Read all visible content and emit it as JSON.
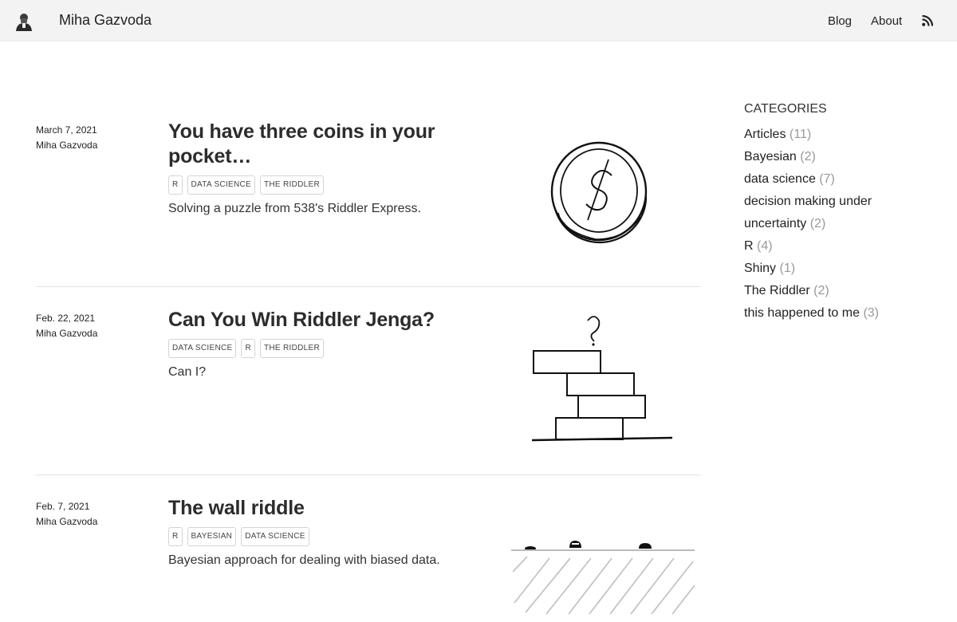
{
  "header": {
    "site_title": "Miha Gazvoda",
    "nav": {
      "blog": "Blog",
      "about": "About"
    },
    "icons": {
      "avatar": "author-avatar-icon",
      "feed": "rss-feed-icon"
    }
  },
  "posts": [
    {
      "date": "March 7, 2021",
      "author": "Miha Gazvoda",
      "title": "You have three coins in your pocket…",
      "tags": [
        "R",
        "DATA SCIENCE",
        "THE RIDDLER"
      ],
      "description": "Solving a puzzle from 538's Riddler Express.",
      "image": "coin-sketch-icon"
    },
    {
      "date": "Feb. 22, 2021",
      "author": "Miha Gazvoda",
      "title": "Can You Win Riddler Jenga?",
      "tags": [
        "DATA SCIENCE",
        "R",
        "THE RIDDLER"
      ],
      "description": "Can I?",
      "image": "jenga-tower-sketch-icon"
    },
    {
      "date": "Feb. 7, 2021",
      "author": "Miha Gazvoda",
      "title": "The wall riddle",
      "tags": [
        "R",
        "BAYESIAN",
        "DATA SCIENCE"
      ],
      "description": "Bayesian approach for dealing with biased data.",
      "image": "wall-sketch-icon"
    }
  ],
  "sidebar": {
    "heading": "CATEGORIES",
    "categories": [
      {
        "name": "Articles",
        "count": "(11)"
      },
      {
        "name": "Bayesian",
        "count": "(2)"
      },
      {
        "name": "data science",
        "count": "(7)"
      },
      {
        "name": "decision making under uncertainty",
        "count": "(2)"
      },
      {
        "name": "R",
        "count": "(4)"
      },
      {
        "name": "Shiny",
        "count": "(1)"
      },
      {
        "name": "The Riddler",
        "count": "(2)"
      },
      {
        "name": "this happened to me",
        "count": "(3)"
      }
    ]
  }
}
